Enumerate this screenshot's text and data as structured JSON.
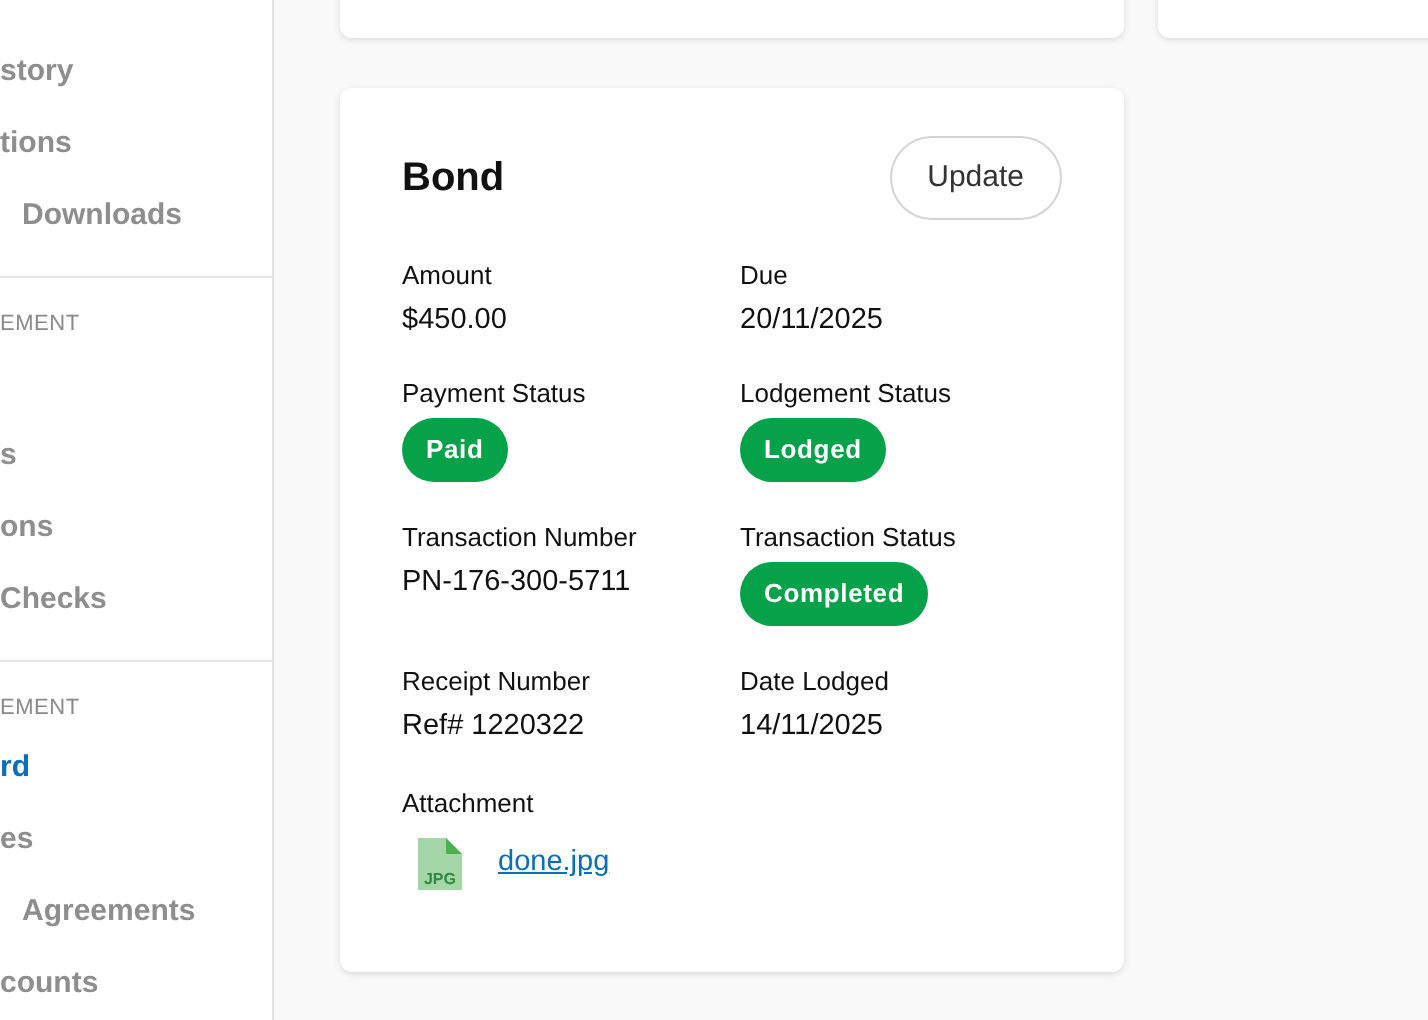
{
  "sidebar": {
    "items": [
      {
        "kind": "blank"
      },
      {
        "kind": "item",
        "label": "story",
        "selected": false
      },
      {
        "kind": "item",
        "label": "tions",
        "selected": false
      },
      {
        "kind": "item",
        "label": "Downloads",
        "indent": true,
        "selected": false
      },
      {
        "kind": "divider"
      },
      {
        "kind": "header",
        "label": "EMENT"
      },
      {
        "kind": "blank"
      },
      {
        "kind": "item",
        "label": "s",
        "selected": false
      },
      {
        "kind": "item",
        "label": "ons",
        "selected": false
      },
      {
        "kind": "item",
        "label": "Checks",
        "selected": false
      },
      {
        "kind": "divider"
      },
      {
        "kind": "header",
        "label": "EMENT"
      },
      {
        "kind": "item",
        "label": "rd",
        "selected": true
      },
      {
        "kind": "item",
        "label": "es",
        "selected": false
      },
      {
        "kind": "item",
        "label": "Agreements",
        "indent": true,
        "selected": false
      },
      {
        "kind": "item",
        "label": "counts",
        "selected": false
      }
    ]
  },
  "card": {
    "title": "Bond",
    "button": "Update",
    "fields": [
      {
        "label": "Amount",
        "kind": "text",
        "value": "$450.00"
      },
      {
        "label": "Due",
        "kind": "text",
        "value": "20/11/2025"
      },
      {
        "label": "Payment Status",
        "kind": "badge",
        "value": "Paid"
      },
      {
        "label": "Lodgement Status",
        "kind": "badge",
        "value": "Lodged"
      },
      {
        "label": "Transaction Number",
        "kind": "text",
        "value": "PN-176-300-5711"
      },
      {
        "label": "Transaction Status",
        "kind": "badge",
        "value": "Completed"
      },
      {
        "label": "Receipt Number",
        "kind": "text",
        "value": "Ref# 1220322"
      },
      {
        "label": "Date Lodged",
        "kind": "text",
        "value": "14/11/2025"
      }
    ],
    "attachment": {
      "label": "Attachment",
      "file_type": "JPG",
      "file_name": "done.jpg"
    }
  }
}
